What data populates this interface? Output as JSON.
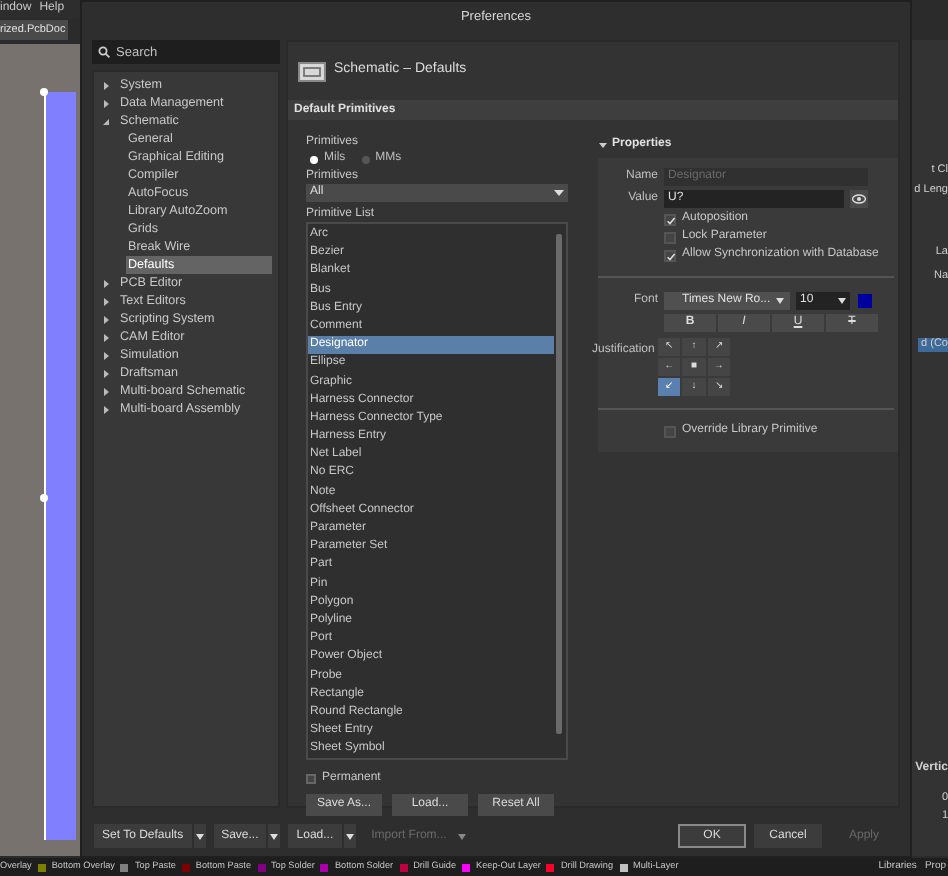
{
  "background": {
    "menu": [
      "indow",
      "Help"
    ],
    "document_tab": "rized.PcbDoc",
    "side_texts": [
      "t Cl",
      "d Leng",
      "La",
      "Na",
      "d (Co",
      "Vertic",
      "0",
      "1"
    ],
    "layer_tabs": [
      {
        "label": "Overlay"
      },
      {
        "label": "Bottom Overlay",
        "color": "#808000"
      },
      {
        "label": "Top Paste",
        "color": "#808080"
      },
      {
        "label": "Bottom Paste",
        "color": "#800000"
      },
      {
        "label": "Top Solder",
        "color": "#800080"
      },
      {
        "label": "Bottom Solder",
        "color": "#aa00aa"
      },
      {
        "label": "Drill Guide",
        "color": "#c00040"
      },
      {
        "label": "Keep-Out Layer",
        "color": "#ff00ff"
      },
      {
        "label": "Drill Drawing",
        "color": "#ff002a"
      },
      {
        "label": "Multi-Layer",
        "color": "#c0c0c0"
      }
    ],
    "panel_tabs": [
      "Libraries",
      "Prop"
    ]
  },
  "dialog": {
    "title": "Preferences",
    "search": {
      "placeholder": "Search"
    },
    "tree": [
      {
        "label": "System",
        "expanded": false,
        "selected": false
      },
      {
        "label": "Data Management",
        "expanded": false,
        "selected": false
      },
      {
        "label": "Schematic",
        "expanded": true,
        "selected": false,
        "children": [
          {
            "label": "General",
            "selected": false
          },
          {
            "label": "Graphical Editing",
            "selected": false
          },
          {
            "label": "Compiler",
            "selected": false
          },
          {
            "label": "AutoFocus",
            "selected": false
          },
          {
            "label": "Library AutoZoom",
            "selected": false
          },
          {
            "label": "Grids",
            "selected": false
          },
          {
            "label": "Break Wire",
            "selected": false
          },
          {
            "label": "Defaults",
            "selected": true
          }
        ]
      },
      {
        "label": "PCB Editor",
        "expanded": false,
        "selected": false
      },
      {
        "label": "Text Editors",
        "expanded": false,
        "selected": false
      },
      {
        "label": "Scripting System",
        "expanded": false,
        "selected": false
      },
      {
        "label": "CAM Editor",
        "expanded": false,
        "selected": false
      },
      {
        "label": "Simulation",
        "expanded": false,
        "selected": false
      },
      {
        "label": "Draftsman",
        "expanded": false,
        "selected": false
      },
      {
        "label": "Multi-board Schematic",
        "expanded": false,
        "selected": false
      },
      {
        "label": "Multi-board Assembly",
        "expanded": false,
        "selected": false
      }
    ],
    "page_title": "Schematic – Defaults",
    "section": "Default Primitives",
    "units_label": "Primitives",
    "units": [
      {
        "label": "Mils",
        "selected": true
      },
      {
        "label": "MMs",
        "selected": false
      }
    ],
    "filter_label": "Primitives",
    "filter_value": "All",
    "list_label": "Primitive List",
    "primitives": [
      {
        "label": "Arc",
        "selected": false
      },
      {
        "label": "Bezier",
        "selected": false
      },
      {
        "label": "Blanket",
        "selected": false
      },
      {
        "label": "Bus",
        "selected": false
      },
      {
        "label": "Bus Entry",
        "selected": false
      },
      {
        "label": "Comment",
        "selected": false
      },
      {
        "label": "Designator",
        "selected": true
      },
      {
        "label": "Ellipse",
        "selected": false
      },
      {
        "label": "Graphic",
        "selected": false
      },
      {
        "label": "Harness Connector",
        "selected": false
      },
      {
        "label": "Harness Connector Type",
        "selected": false
      },
      {
        "label": "Harness Entry",
        "selected": false
      },
      {
        "label": "Net Label",
        "selected": false
      },
      {
        "label": "No ERC",
        "selected": false
      },
      {
        "label": "Note",
        "selected": false
      },
      {
        "label": "Offsheet Connector",
        "selected": false
      },
      {
        "label": "Parameter",
        "selected": false
      },
      {
        "label": "Parameter Set",
        "selected": false
      },
      {
        "label": "Part",
        "selected": false
      },
      {
        "label": "Pin",
        "selected": false
      },
      {
        "label": "Polygon",
        "selected": false
      },
      {
        "label": "Polyline",
        "selected": false
      },
      {
        "label": "Port",
        "selected": false
      },
      {
        "label": "Power Object",
        "selected": false
      },
      {
        "label": "Probe",
        "selected": false
      },
      {
        "label": "Rectangle",
        "selected": false
      },
      {
        "label": "Round Rectangle",
        "selected": false
      },
      {
        "label": "Sheet Entry",
        "selected": false
      },
      {
        "label": "Sheet Symbol",
        "selected": false
      }
    ],
    "permanent": {
      "label": "Permanent",
      "checked": false
    },
    "list_buttons": [
      "Save As...",
      "Load...",
      "Reset All"
    ],
    "properties": {
      "title": "Properties",
      "expanded": true,
      "name": {
        "label": "Name",
        "value": "Designator",
        "disabled": true
      },
      "value": {
        "label": "Value",
        "value": "U?"
      },
      "options": [
        {
          "label": "Autoposition",
          "checked": true
        },
        {
          "label": "Lock Parameter",
          "checked": false
        },
        {
          "label": "Allow Synchronization with Database",
          "checked": true
        }
      ],
      "font_label": "Font",
      "font": "Times New Ro...",
      "size": "10",
      "color": "#0000a0",
      "styles": [
        {
          "label": "B",
          "selected": false
        },
        {
          "label": "I",
          "selected": false
        },
        {
          "label": "U",
          "selected": false
        },
        {
          "label": "T",
          "selected": false
        }
      ],
      "justification_label": "Justification",
      "justification": [
        {
          "label": "↖",
          "selected": false
        },
        {
          "label": "↑",
          "selected": false
        },
        {
          "label": "↗",
          "selected": false
        },
        {
          "label": "←",
          "selected": false
        },
        {
          "label": "■",
          "selected": false
        },
        {
          "label": "→",
          "selected": false
        },
        {
          "label": "↙",
          "selected": true
        },
        {
          "label": "↓",
          "selected": false
        },
        {
          "label": "↘",
          "selected": false
        }
      ],
      "override": {
        "label": "Override Library Primitive",
        "checked": false
      }
    },
    "footer": [
      {
        "label": "Set To Defaults",
        "dropdown": true,
        "disabled": false
      },
      {
        "label": "Save...",
        "dropdown": true,
        "disabled": false
      },
      {
        "label": "Load...",
        "dropdown": true,
        "disabled": false
      },
      {
        "label": "Import From...",
        "dropdown": true,
        "disabled": true
      },
      {
        "label": "OK",
        "dropdown": false,
        "disabled": false,
        "default": true
      },
      {
        "label": "Cancel",
        "dropdown": false,
        "disabled": false
      },
      {
        "label": "Apply",
        "dropdown": false,
        "disabled": true
      }
    ]
  }
}
